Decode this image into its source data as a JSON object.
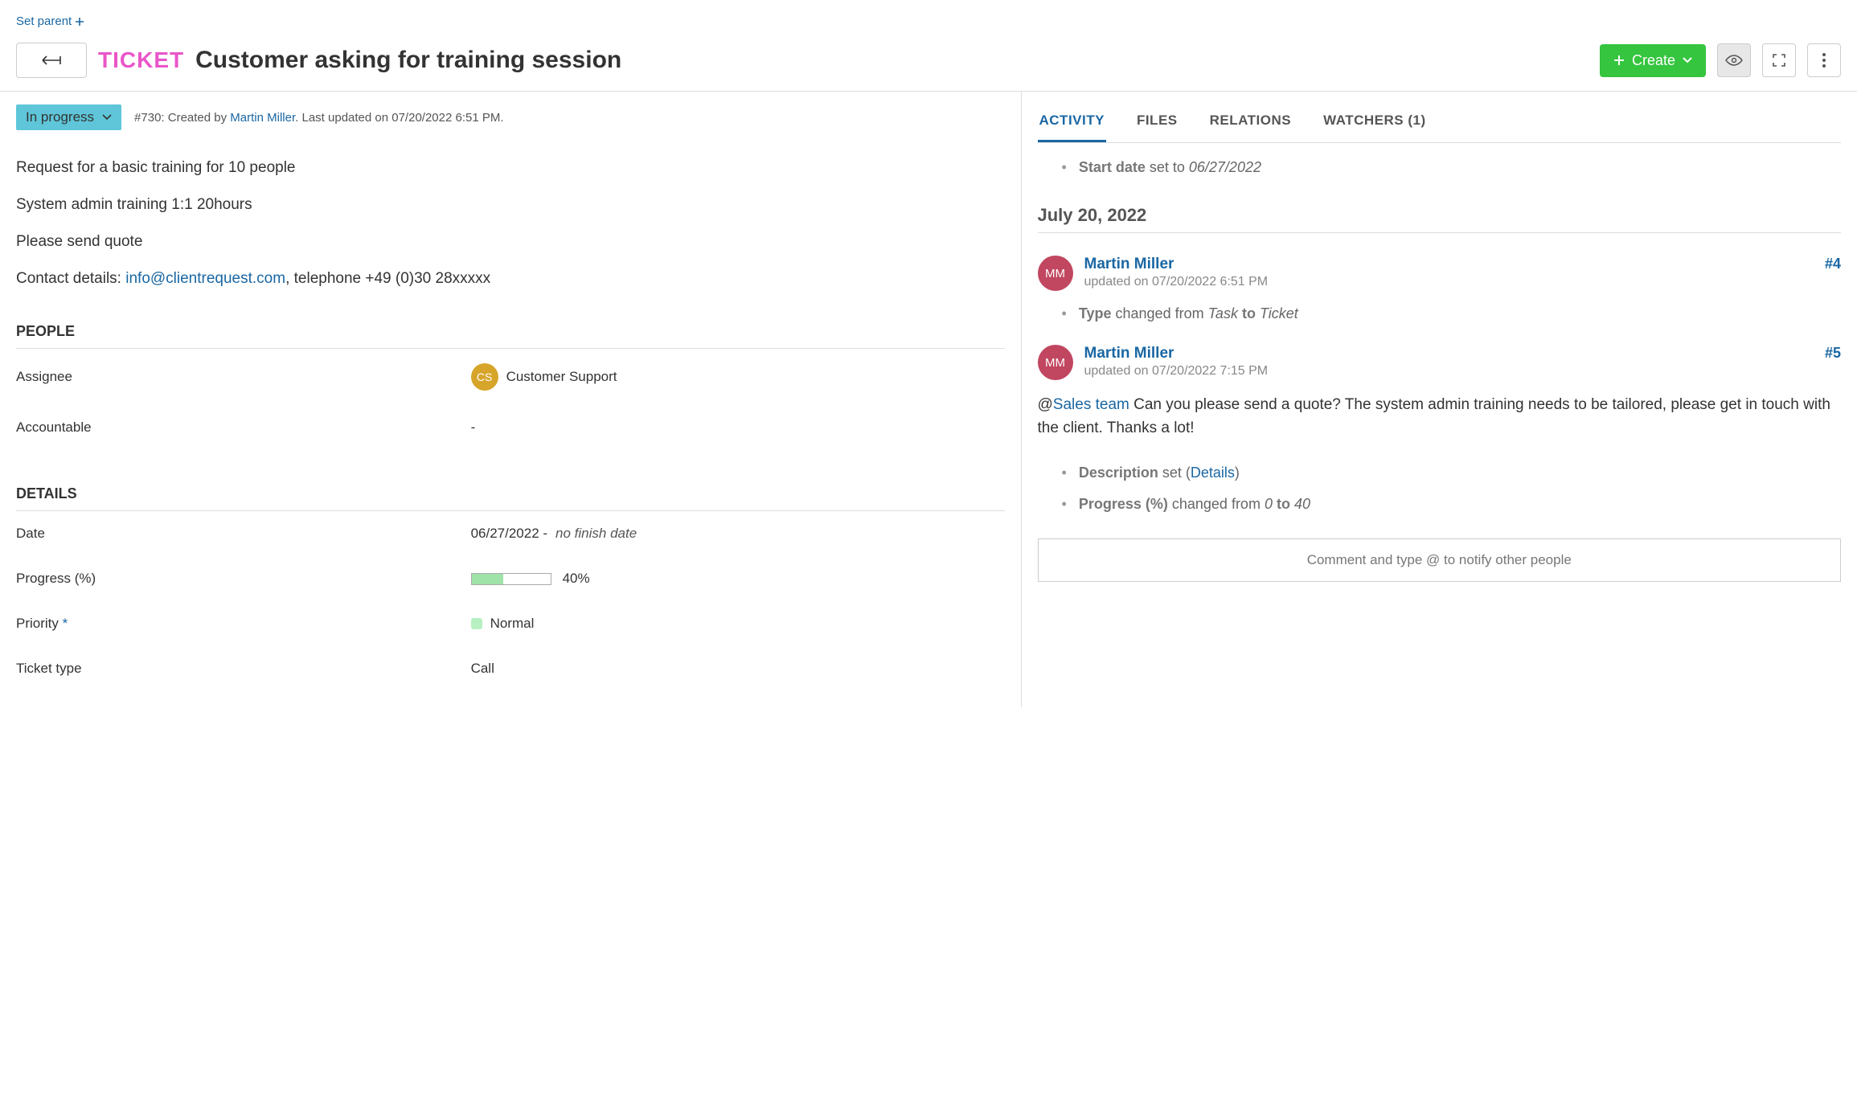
{
  "parent": {
    "set_parent_label": "Set parent"
  },
  "header": {
    "type_label": "TICKET",
    "title": "Customer asking for training session",
    "create_label": "Create"
  },
  "status": {
    "label": "In progress",
    "ticket_ref": "#730: Created by ",
    "author": "Martin Miller",
    "updated": ". Last updated on 07/20/2022 6:51 PM."
  },
  "description": {
    "line1": "Request for a basic training for 10 people",
    "line2": "System admin training 1:1 20hours",
    "line3": "Please send quote",
    "contact_label": "Contact details: ",
    "contact_email": "info@clientrequest.com",
    "contact_rest": ", telephone +49 (0)30 28xxxxx"
  },
  "people": {
    "section": "PEOPLE",
    "assignee_label": "Assignee",
    "assignee_initials": "CS",
    "assignee_name": "Customer Support",
    "accountable_label": "Accountable",
    "accountable_value": "-"
  },
  "details": {
    "section": "DETAILS",
    "date_label": "Date",
    "date_value": "06/27/2022 - ",
    "date_nofinish": "no finish date",
    "progress_label": "Progress (%)",
    "progress_pct": 40,
    "progress_pct_label": "40%",
    "priority_label": "Priority ",
    "priority_value": "Normal",
    "ticket_type_label": "Ticket type",
    "ticket_type_value": "Call"
  },
  "tabs": {
    "activity": "ACTIVITY",
    "files": "FILES",
    "relations": "RELATIONS",
    "watchers": "WATCHERS (1)"
  },
  "activity": {
    "top_change_field": "Start date",
    "top_change_mid": " set to ",
    "top_change_value": "06/27/2022",
    "date_sep": "July 20, 2022",
    "entries": [
      {
        "initials": "MM",
        "author": "Martin Miller",
        "meta": "updated on 07/20/2022 6:51 PM",
        "anchor": "#4",
        "change_field": "Type",
        "change_mid1": " changed from ",
        "change_from": "Task",
        "change_mid2": " to ",
        "change_to": "Ticket"
      },
      {
        "initials": "MM",
        "author": "Martin Miller",
        "meta": "updated on 07/20/2022 7:15 PM",
        "anchor": "#5",
        "mention": "Sales team",
        "comment_rest": " Can you please send a quote? The system admin training needs to be tailored, please get in touch with the client. Thanks a lot!",
        "sub1_field": "Description",
        "sub1_mid": " set (",
        "sub1_link": "Details",
        "sub1_close": ")",
        "sub2_field": "Progress (%)",
        "sub2_mid1": " changed from ",
        "sub2_from": "0",
        "sub2_mid2": " to ",
        "sub2_to": "40"
      }
    ],
    "comment_placeholder": "Comment and type @ to notify other people"
  }
}
